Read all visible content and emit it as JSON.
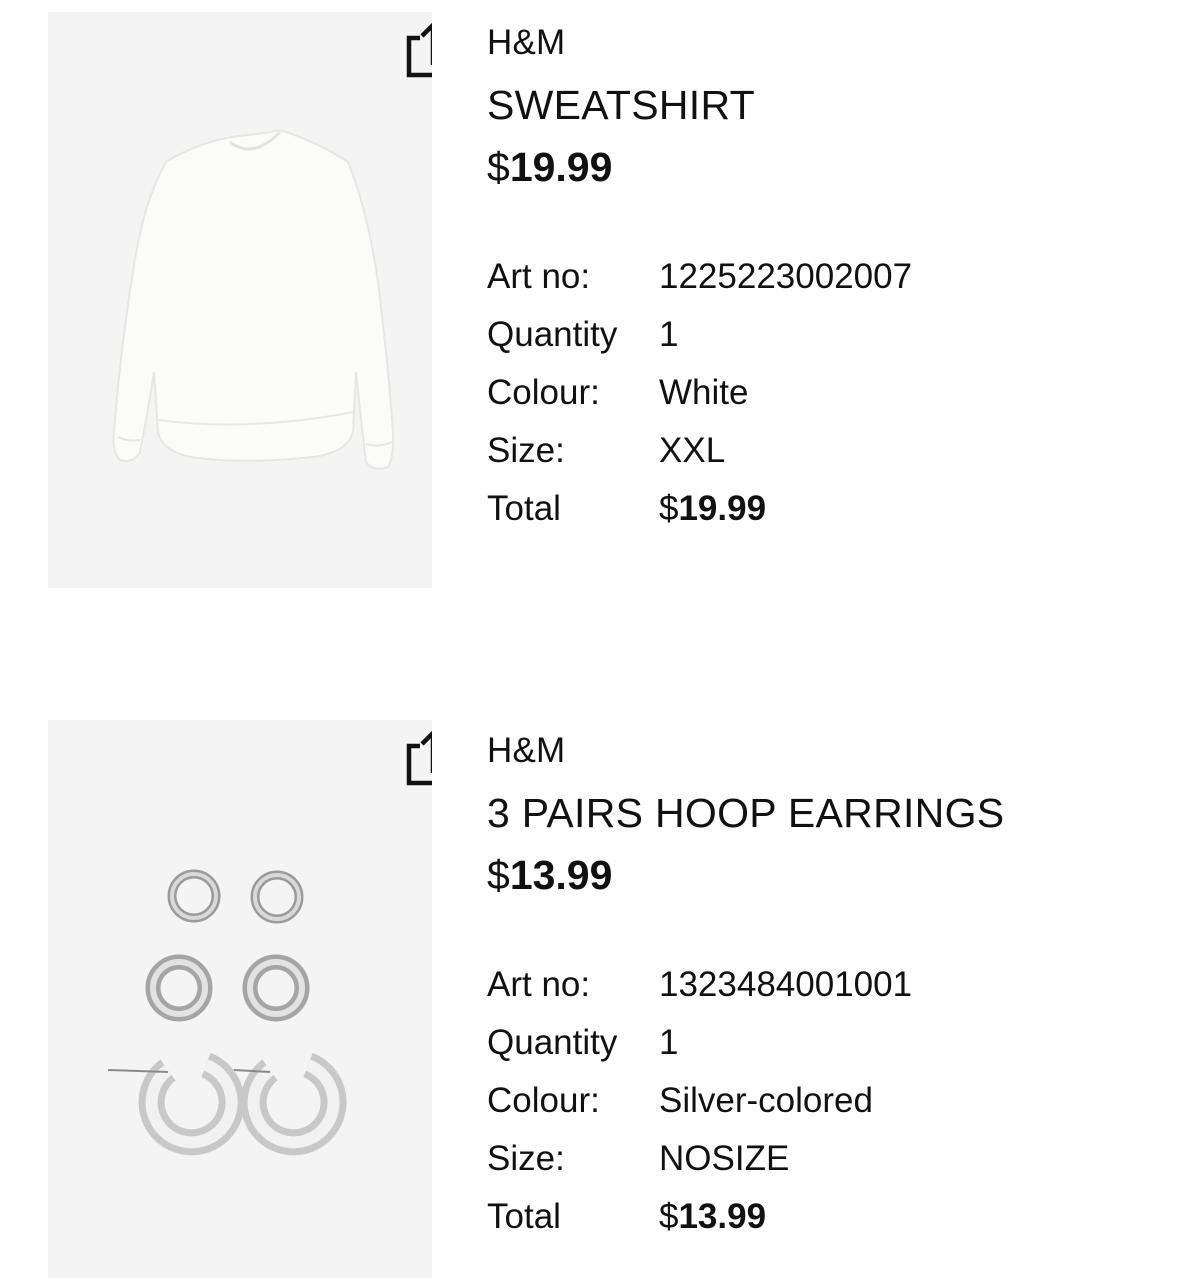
{
  "products": [
    {
      "brand": "H&M",
      "title": "SWEATSHIRT",
      "price_currency": "$",
      "price_amount": "19.99",
      "details": {
        "art_no_label": "Art no:",
        "art_no": "1225223002007",
        "quantity_label": "Quantity",
        "quantity": "1",
        "colour_label": "Colour:",
        "colour": "White",
        "size_label": "Size:",
        "size": "XXL",
        "total_label": "Total",
        "total_currency": "$",
        "total_amount": "19.99"
      },
      "share_icon": "share-icon",
      "image": "white-sweatshirt"
    },
    {
      "brand": "H&M",
      "title": "3 PAIRS HOOP EARRINGS",
      "price_currency": "$",
      "price_amount": "13.99",
      "details": {
        "art_no_label": "Art no:",
        "art_no": "1323484001001",
        "quantity_label": "Quantity",
        "quantity": "1",
        "colour_label": "Colour:",
        "colour": "Silver-colored",
        "size_label": "Size:",
        "size": "NOSIZE",
        "total_label": "Total",
        "total_currency": "$",
        "total_amount": "13.99"
      },
      "share_icon": "share-icon",
      "image": "silver-hoop-earrings"
    }
  ],
  "colors": {
    "text": "#111111",
    "image_background": "#f4f4f4",
    "background": "#ffffff"
  }
}
